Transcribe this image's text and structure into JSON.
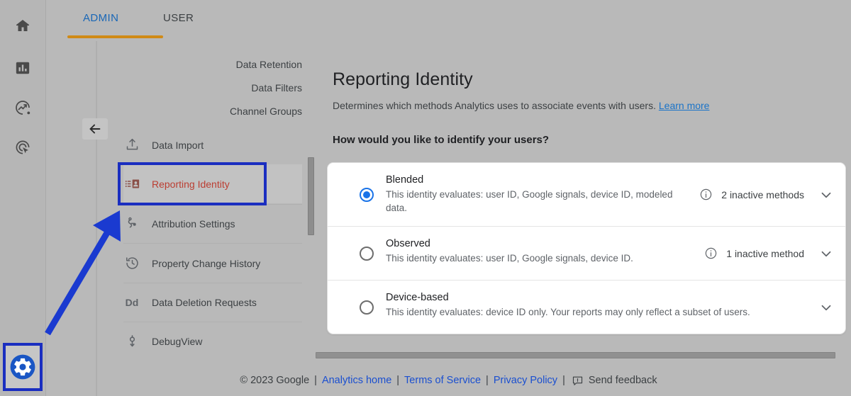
{
  "tabs": [
    {
      "id": "admin",
      "label": "ADMIN",
      "active": true
    },
    {
      "id": "user",
      "label": "USER",
      "active": false
    }
  ],
  "rail": {
    "icons": [
      "home-icon",
      "bar-chart-icon",
      "trend-explore-icon",
      "advertising-icon",
      "gear-icon"
    ]
  },
  "nav": {
    "back_label": "back-arrow",
    "subitems": [
      {
        "label": "Data Retention"
      },
      {
        "label": "Data Filters"
      },
      {
        "label": "Channel Groups"
      }
    ],
    "items": [
      {
        "label": "Data Import",
        "icon": "upload-icon",
        "selected": false
      },
      {
        "label": "Reporting Identity",
        "icon": "identity-card-icon",
        "selected": true
      },
      {
        "label": "Attribution Settings",
        "icon": "attribution-icon",
        "selected": false
      },
      {
        "label": "Property Change History",
        "icon": "history-icon",
        "selected": false
      },
      {
        "label": "Data Deletion Requests",
        "icon": "dd-icon",
        "selected": false
      },
      {
        "label": "DebugView",
        "icon": "debug-icon",
        "selected": false
      }
    ]
  },
  "main": {
    "title": "Reporting Identity",
    "description": "Determines which methods Analytics uses to associate events with users.",
    "learn_more": "Learn more",
    "question": "How would you like to identify your users?",
    "options": [
      {
        "id": "blended",
        "title": "Blended",
        "description": "This identity evaluates: user ID, Google signals, device ID, modeled data.",
        "selected": true,
        "inactive": "2 inactive methods",
        "has_info": true
      },
      {
        "id": "observed",
        "title": "Observed",
        "description": "This identity evaluates: user ID, Google signals, device ID.",
        "selected": false,
        "inactive": "1 inactive method",
        "has_info": true
      },
      {
        "id": "device-based",
        "title": "Device-based",
        "description": "This identity evaluates: device ID only. Your reports may only reflect a subset of users.",
        "selected": false,
        "inactive": "",
        "has_info": false
      }
    ]
  },
  "footer": {
    "copyright": "© 2023 Google",
    "sep": "|",
    "links": [
      {
        "label": "Analytics home"
      },
      {
        "label": "Terms of Service"
      },
      {
        "label": "Privacy Policy"
      }
    ],
    "feedback": "Send feedback"
  },
  "annotations": {
    "highlight_color": "#1a2ec0",
    "arrow_color": "#1a3ad0"
  },
  "colors": {
    "accent_blue": "#1a73e8",
    "tab_active": "#1967b7",
    "tab_underline": "#d08a16",
    "selected_item_text": "#bb3e32",
    "page_bg": "#b9b9b9"
  }
}
